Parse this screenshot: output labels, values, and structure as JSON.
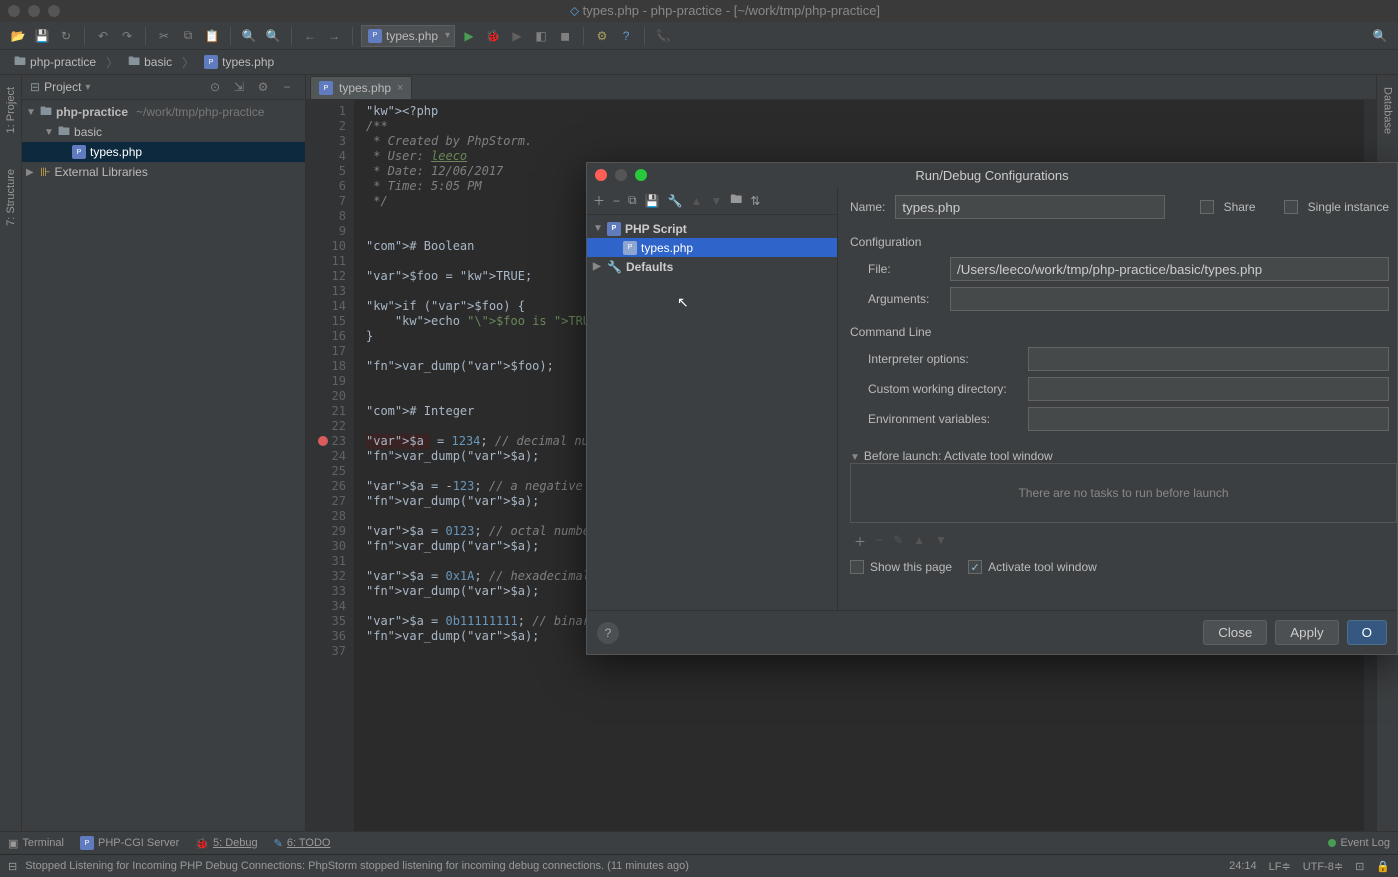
{
  "window": {
    "title_file": "types.php",
    "title_project": "php-practice",
    "title_path": "[~/work/tmp/php-practice]"
  },
  "toolbar": {
    "run_config": "types.php"
  },
  "breadcrumb": {
    "items": [
      "php-practice",
      "basic",
      "types.php"
    ]
  },
  "project_panel": {
    "title": "Project",
    "root_name": "php-practice",
    "root_path": "~/work/tmp/php-practice",
    "folder_basic": "basic",
    "file_types": "types.php",
    "external_libs": "External Libraries"
  },
  "editor": {
    "tab": "types.php",
    "lines": [
      "1",
      "2",
      "3",
      "4",
      "5",
      "6",
      "7",
      "8",
      "9",
      "10",
      "11",
      "12",
      "13",
      "14",
      "15",
      "16",
      "17",
      "18",
      "19",
      "20",
      "21",
      "22",
      "23",
      "24",
      "25",
      "26",
      "27",
      "28",
      "29",
      "30",
      "31",
      "32",
      "33",
      "34",
      "35",
      "36",
      "37"
    ],
    "breakpoint_line": 23,
    "code_plain": "<?php\n/**\n * Created by PhpStorm.\n * User: leeco\n * Date: 12/06/2017\n * Time: 5:05 PM\n */\n\n\n# Boolean\n\n$foo = TRUE;\n\nif ($foo) {\n    echo \"\\$foo is TRUE\\n\";\n}\n\nvar_dump($foo);\n\n\n# Integer\n\n$a = 1234; // decimal number\nvar_dump($a);\n\n$a = -123; // a negative number\nvar_dump($a);\n\n$a = 0123; // octal number (equi\nvar_dump($a);\n\n$a = 0x1A; // hexadecimal number\nvar_dump($a);\n\n$a = 0b11111111; // binary number\nvar_dump($a);\n"
  },
  "left_tabs": {
    "project": "1: Project",
    "structure": "7: Structure"
  },
  "right_tabs": {
    "database": "Database"
  },
  "bottom_tabs": {
    "terminal": "Terminal",
    "php_cgi": "PHP-CGI Server",
    "debug": "5: Debug",
    "todo": "6: TODO",
    "event_log": "Event Log"
  },
  "status": {
    "message": "Stopped Listening for Incoming PHP Debug Connections: PhpStorm stopped listening for incoming debug connections. (11 minutes ago)",
    "pos": "24:14",
    "line_sep": "LF≑",
    "encoding": "UTF-8≑",
    "context": "⊡"
  },
  "dialog": {
    "title": "Run/Debug Configurations",
    "tree": {
      "php_script": "PHP Script",
      "types": "types.php",
      "defaults": "Defaults"
    },
    "form": {
      "name_label": "Name:",
      "name_value": "types.php",
      "share_label": "Share",
      "single_instance_label": "Single instance",
      "config_section": "Configuration",
      "file_label": "File:",
      "file_value": "/Users/leeco/work/tmp/php-practice/basic/types.php",
      "args_label": "Arguments:",
      "args_value": "",
      "cmdline_section": "Command Line",
      "interp_label": "Interpreter options:",
      "interp_value": "",
      "cwd_label": "Custom working directory:",
      "cwd_value": "",
      "env_label": "Environment variables:",
      "env_value": "",
      "before_launch_title": "Before launch: Activate tool window",
      "no_tasks": "There are no tasks to run before launch",
      "show_page": "Show this page",
      "activate_tool": "Activate tool window"
    },
    "buttons": {
      "close": "Close",
      "apply": "Apply",
      "ok": "O"
    }
  }
}
